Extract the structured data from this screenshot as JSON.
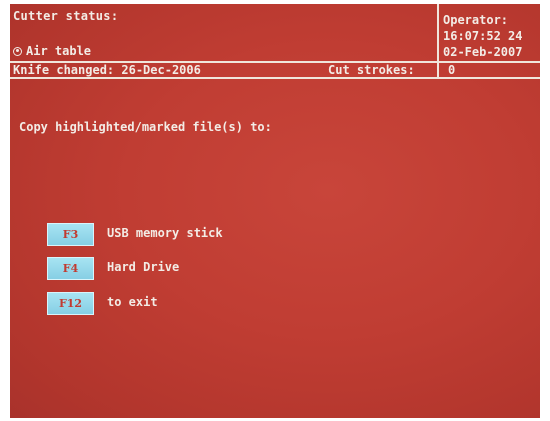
{
  "header": {
    "title": "Cutter status:",
    "air_table": "Air table",
    "operator_label": "Operator:",
    "time": "16:07:52  24",
    "date": "02-Feb-2007"
  },
  "status": {
    "knife_changed": "Knife changed: 26-Dec-2006",
    "cut_strokes_label": "Cut strokes:",
    "cut_strokes_value": "0"
  },
  "prompt": "Copy highlighted/marked file(s) to:",
  "options": [
    {
      "key": "F3",
      "label": "USB memory stick"
    },
    {
      "key": "F4",
      "label": "Hard Drive"
    },
    {
      "key": "F12",
      "label": "to exit"
    }
  ],
  "colors": {
    "background": "#c03d33",
    "text": "#f3ece6",
    "key_fill": "#9adbed",
    "key_text": "#c23a30"
  },
  "icons": {
    "air_table": "radio-button-icon"
  }
}
